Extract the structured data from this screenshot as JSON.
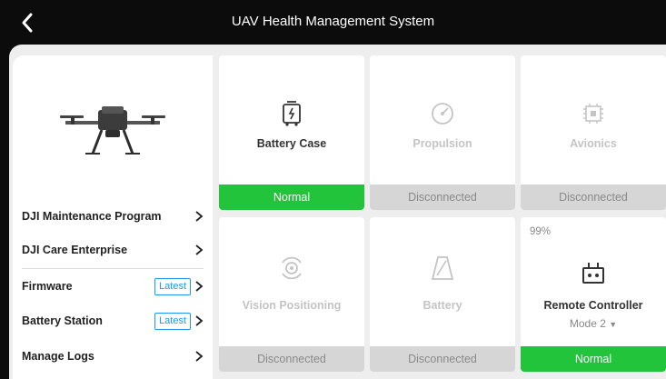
{
  "header": {
    "title": "UAV Health Management System"
  },
  "sidebar": {
    "items": [
      {
        "label": "DJI Maintenance Program"
      },
      {
        "label": "DJI Care Enterprise"
      },
      {
        "label": "Firmware",
        "badge": "Latest"
      },
      {
        "label": "Battery Station",
        "badge": "Latest"
      },
      {
        "label": "Manage Logs"
      }
    ]
  },
  "modules": [
    {
      "name": "Battery Case",
      "status": "Normal",
      "icon": "battery-case-icon"
    },
    {
      "name": "Propulsion",
      "status": "Disconnected",
      "icon": "propulsion-icon"
    },
    {
      "name": "Avionics",
      "status": "Disconnected",
      "icon": "avionics-icon"
    },
    {
      "name": "Vision Positioning",
      "status": "Disconnected",
      "icon": "vision-positioning-icon"
    },
    {
      "name": "Battery",
      "status": "Disconnected",
      "icon": "battery-icon"
    },
    {
      "name": "Remote Controller",
      "status": "Normal",
      "icon": "remote-controller-icon",
      "battery_level": "99%",
      "mode": "Mode 2"
    }
  ],
  "colors": {
    "normal": "#21c43b",
    "disconnected": "#d6d6d6",
    "accent": "#2196f3"
  }
}
